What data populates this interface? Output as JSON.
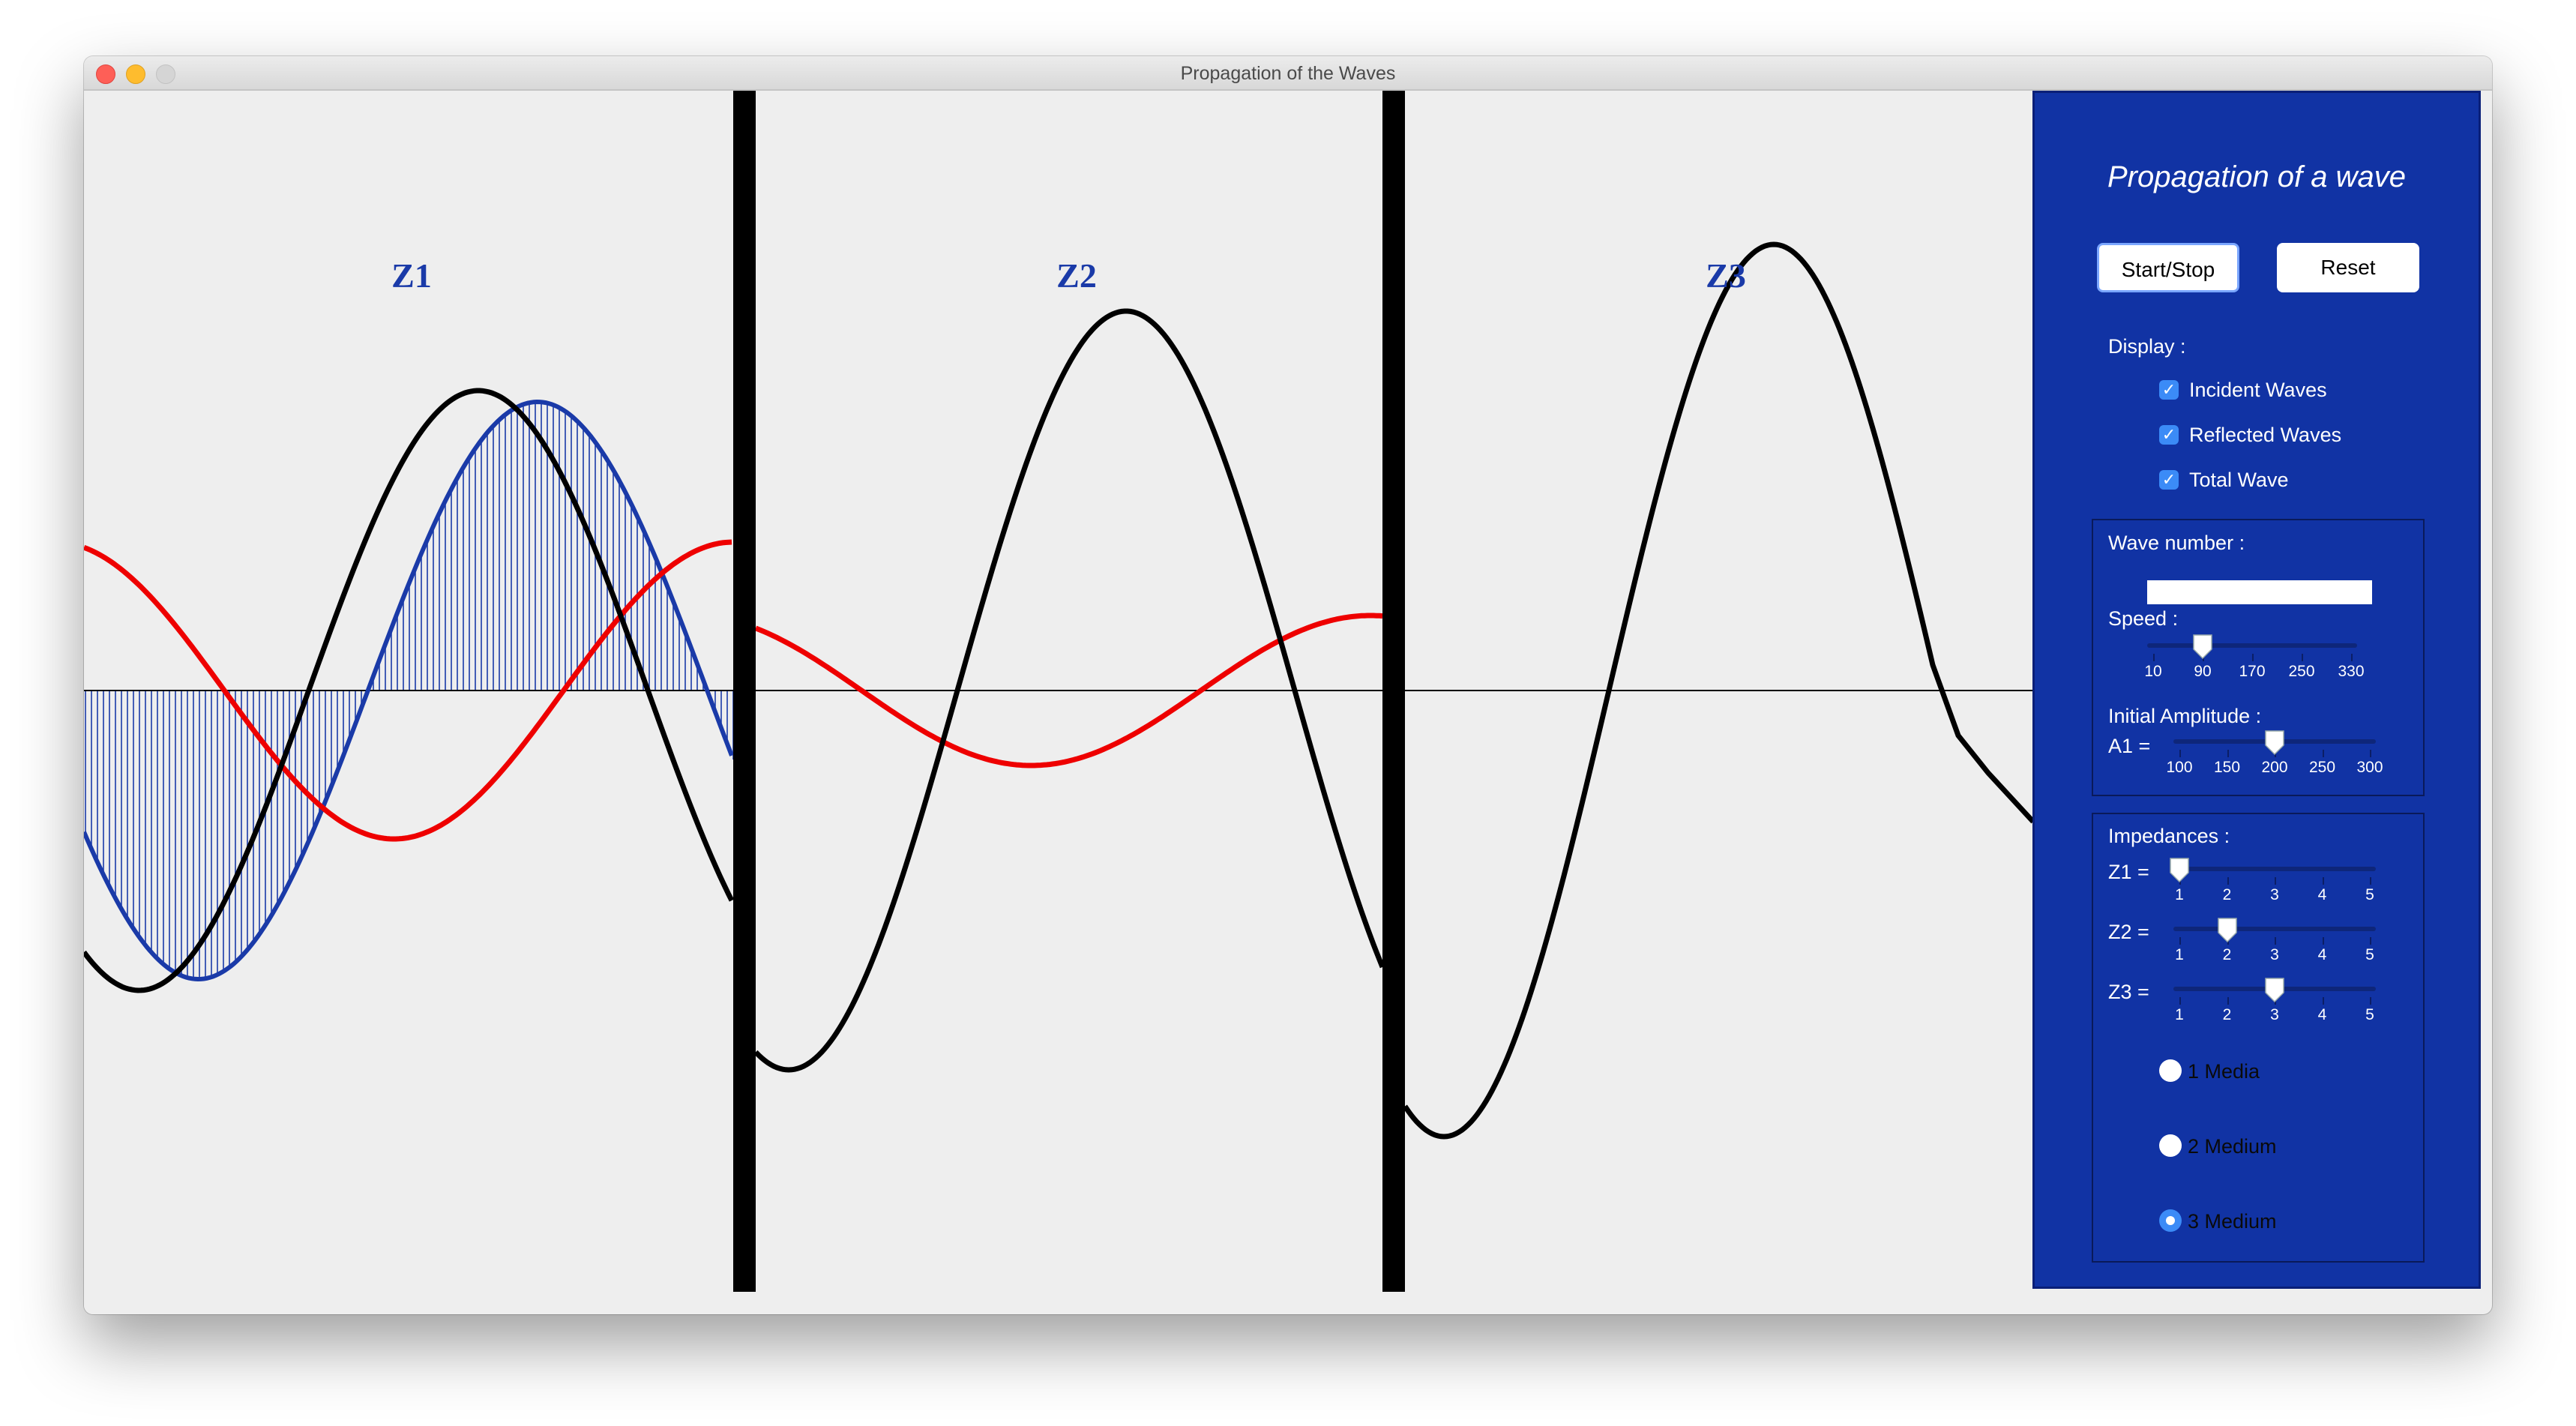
{
  "window": {
    "title": "Propagation of the Waves"
  },
  "canvas": {
    "zone_labels": [
      "Z1",
      "Z2",
      "Z3"
    ],
    "colors": {
      "incident": "#1a3aa8",
      "reflected": "#ee0000",
      "total": "#000000",
      "label": "#1a3aa8"
    }
  },
  "panel": {
    "title": "Propagation of a wave",
    "start_stop": "Start/Stop",
    "reset": "Reset",
    "display_label": "Display :",
    "checkboxes": [
      {
        "label": "Incident Waves",
        "checked": true
      },
      {
        "label": "Reflected Waves",
        "checked": true
      },
      {
        "label": "Total Wave",
        "checked": true
      }
    ],
    "wave_number_label": "Wave number :",
    "wave_number_value": "",
    "speed_label": "Speed :",
    "speed": {
      "ticks": [
        "10",
        "90",
        "170",
        "250",
        "330"
      ],
      "value": 90,
      "min": 10,
      "max": 330
    },
    "initial_amplitude_label": "Initial Amplitude :",
    "a1_label": "A1 =",
    "a1": {
      "ticks": [
        "100",
        "150",
        "200",
        "250",
        "300"
      ],
      "value": 200,
      "min": 100,
      "max": 300
    },
    "impedances_label": "Impedances :",
    "impedances": [
      {
        "label": "Z1 =",
        "value": 1,
        "ticks": [
          "1",
          "2",
          "3",
          "4",
          "5"
        ]
      },
      {
        "label": "Z2 =",
        "value": 2,
        "ticks": [
          "1",
          "2",
          "3",
          "4",
          "5"
        ]
      },
      {
        "label": "Z3 =",
        "value": 3,
        "ticks": [
          "1",
          "2",
          "3",
          "4",
          "5"
        ]
      }
    ],
    "media_options": [
      {
        "label": "1 Media",
        "selected": false
      },
      {
        "label": "2 Medium",
        "selected": false
      },
      {
        "label": "3 Medium",
        "selected": true
      }
    ]
  }
}
